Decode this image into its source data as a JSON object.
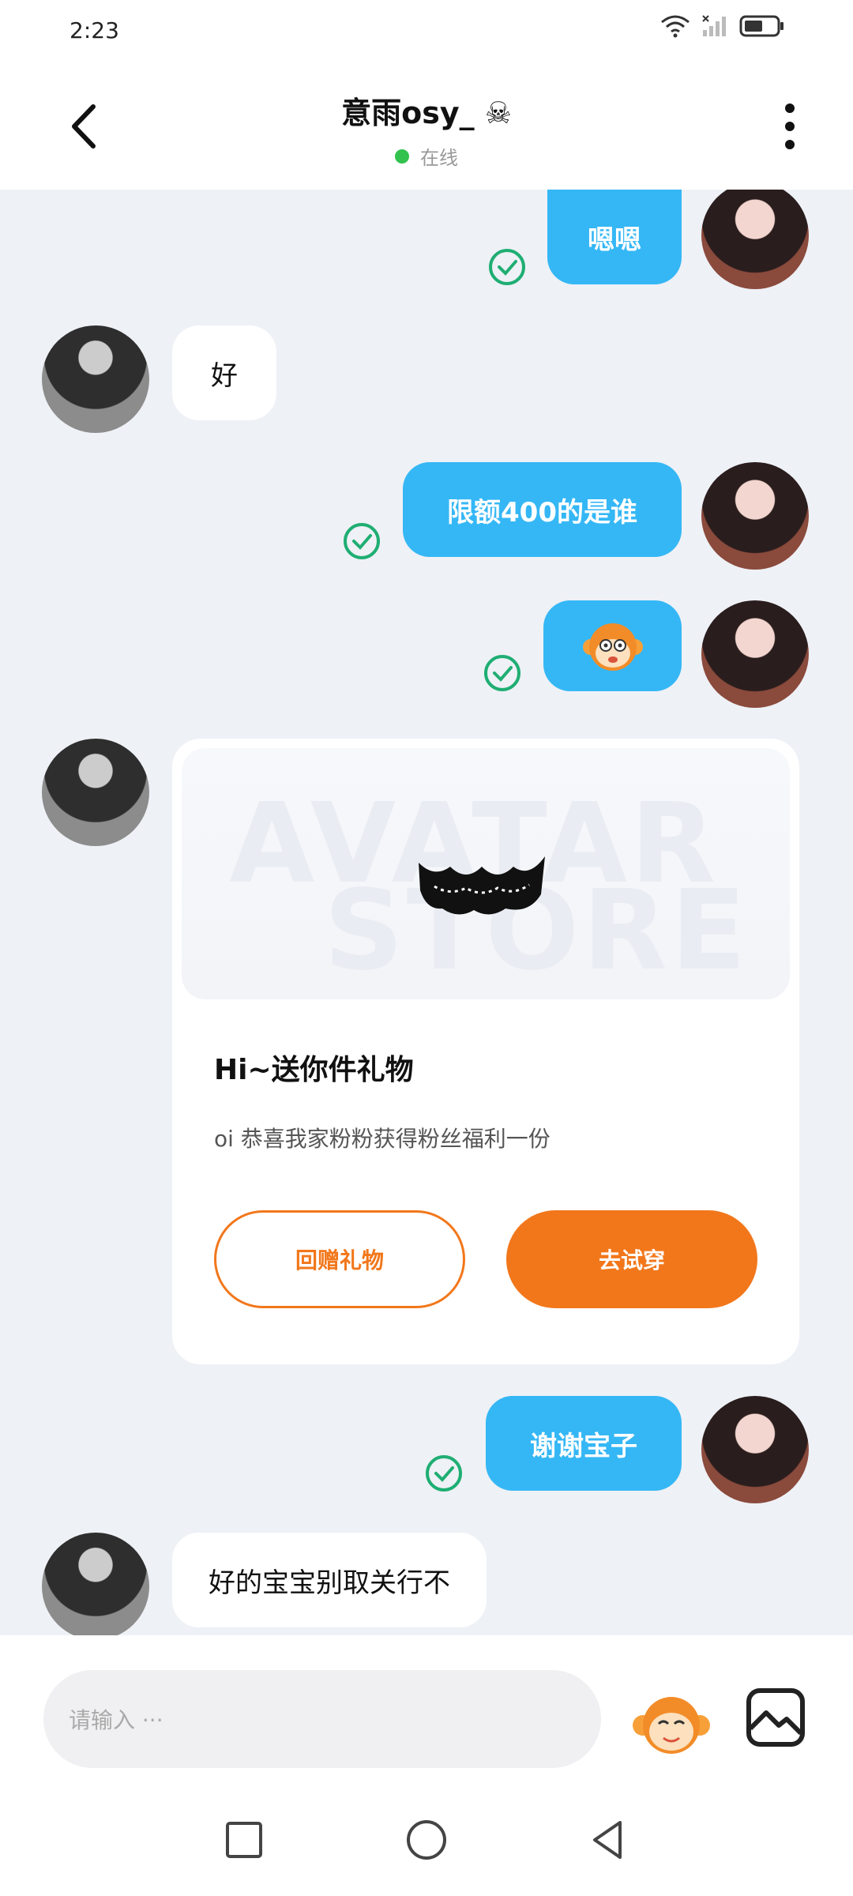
{
  "status": {
    "time": "2:23"
  },
  "header": {
    "name": "意雨osy_",
    "skull": "☠",
    "status": "在线"
  },
  "messages": {
    "m1": "嗯嗯",
    "m2": "好",
    "m3": "限额400的是谁",
    "m6": "谢谢宝子",
    "m7": "好的宝宝别取关行不"
  },
  "gift": {
    "watermark_1": "AVATAR",
    "watermark_2": "STORE",
    "title": "Hi~送你件礼物",
    "desc": "oi 恭喜我家粉粉获得粉丝福利一份",
    "return_label": "回赠礼物",
    "try_label": "去试穿"
  },
  "input": {
    "placeholder": "请输入 ···"
  },
  "colors": {
    "bubble_me": "#35b7f5",
    "accent": "#f2771b",
    "check": "#1fae73",
    "online": "#32c24d"
  }
}
